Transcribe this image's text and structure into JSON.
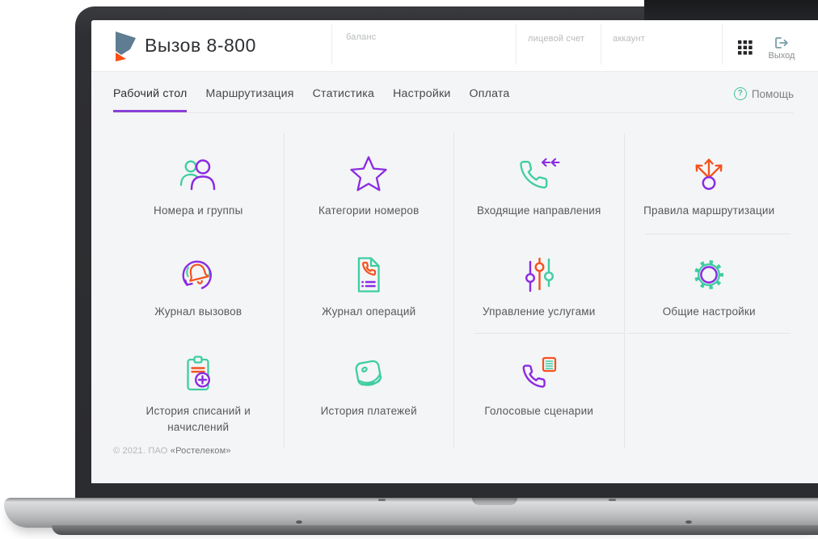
{
  "app": {
    "logo_icon": "rostelecom-logo-icon",
    "title": "Вызов 8-800"
  },
  "header": {
    "balance_label": "баланс",
    "personal_account_label": "лицевой счет",
    "account_label": "аккаунт",
    "apps_icon": "apps-grid-icon",
    "logout": {
      "icon": "logout-icon",
      "label": "Выход"
    }
  },
  "nav": {
    "tabs": [
      {
        "label": "Рабочий стол",
        "active": true
      },
      {
        "label": "Маршрутизация",
        "active": false
      },
      {
        "label": "Статистика",
        "active": false
      },
      {
        "label": "Настройки",
        "active": false
      },
      {
        "label": "Оплата",
        "active": false
      }
    ],
    "help": {
      "icon": "question-circle-icon",
      "label": "Помощь"
    }
  },
  "tiles": [
    {
      "label": "Номера и группы",
      "icon": "users-icon"
    },
    {
      "label": "Категории номеров",
      "icon": "star-icon"
    },
    {
      "label": "Входящие направления",
      "icon": "incoming-call-icon"
    },
    {
      "label": "Правила маршрутизации",
      "icon": "routing-arrows-icon"
    },
    {
      "label": "Журнал вызовов",
      "icon": "call-log-bell-icon"
    },
    {
      "label": "Журнал операций",
      "icon": "operations-log-document-icon"
    },
    {
      "label": "Управление услугами",
      "icon": "sliders-icon"
    },
    {
      "label": "Общие настройки",
      "icon": "gear-icon"
    },
    {
      "label": "История списаний и начислений",
      "icon": "charges-history-clipboard-icon"
    },
    {
      "label": "История платежей",
      "icon": "payments-history-wallet-icon"
    },
    {
      "label": "Голосовые сценарии",
      "icon": "voice-scenarios-phone-icon"
    }
  ],
  "footer": {
    "copyright_prefix": "© 2021. ПАО ",
    "company": "«Ростелеком»"
  },
  "colors": {
    "accent_purple": "#8A3FD6",
    "icon_purple": "#8B2BE2",
    "icon_teal": "#3FCDA2",
    "icon_orange": "#F4521E",
    "help_green": "#43C39C",
    "logo_slate": "#5E7D92",
    "logo_orange": "#FF4E14"
  }
}
